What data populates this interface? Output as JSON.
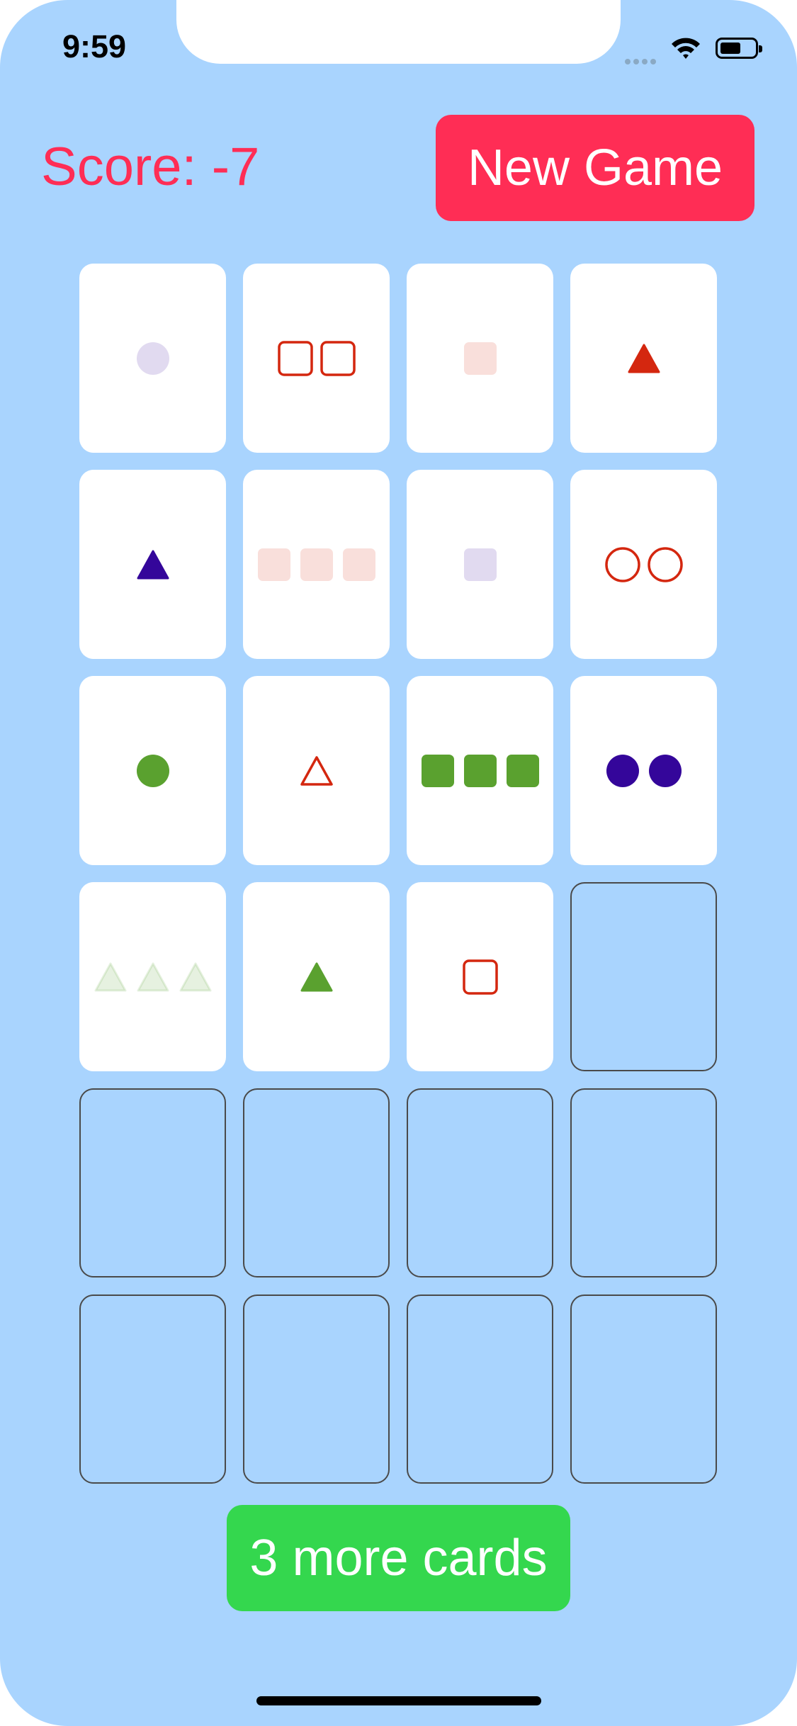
{
  "status_bar": {
    "time": "9:59",
    "signal_icon": "cellular-signal-icon",
    "wifi_icon": "wifi-icon",
    "battery_icon": "battery-icon"
  },
  "header": {
    "score_text": "Score: -7",
    "new_game_label": "New Game"
  },
  "colors": {
    "background": "#a9d4fe",
    "accent_red": "#ff2d55",
    "accent_green": "#34d74e",
    "card_red": "#d4270f",
    "card_green": "#5aa12f",
    "card_purple": "#34069a"
  },
  "cards": [
    {
      "count": 1,
      "shape": "circle",
      "color": "purple",
      "fill": "shaded"
    },
    {
      "count": 2,
      "shape": "square",
      "color": "red",
      "fill": "outline"
    },
    {
      "count": 1,
      "shape": "square",
      "color": "red",
      "fill": "shaded"
    },
    {
      "count": 1,
      "shape": "triangle",
      "color": "red",
      "fill": "solid"
    },
    {
      "count": 1,
      "shape": "triangle",
      "color": "purple",
      "fill": "solid"
    },
    {
      "count": 3,
      "shape": "square",
      "color": "red",
      "fill": "shaded"
    },
    {
      "count": 1,
      "shape": "square",
      "color": "purple",
      "fill": "shaded"
    },
    {
      "count": 2,
      "shape": "circle",
      "color": "red",
      "fill": "outline"
    },
    {
      "count": 1,
      "shape": "circle",
      "color": "green",
      "fill": "solid"
    },
    {
      "count": 1,
      "shape": "triangle",
      "color": "red",
      "fill": "outline"
    },
    {
      "count": 3,
      "shape": "square",
      "color": "green",
      "fill": "solid"
    },
    {
      "count": 2,
      "shape": "circle",
      "color": "purple",
      "fill": "solid"
    },
    {
      "count": 3,
      "shape": "triangle",
      "color": "green",
      "fill": "shaded"
    },
    {
      "count": 1,
      "shape": "triangle",
      "color": "green",
      "fill": "solid"
    },
    {
      "count": 1,
      "shape": "square",
      "color": "red",
      "fill": "outline"
    },
    {
      "empty": true
    },
    {
      "empty": true
    },
    {
      "empty": true
    },
    {
      "empty": true
    },
    {
      "empty": true
    },
    {
      "empty": true
    },
    {
      "empty": true
    },
    {
      "empty": true
    },
    {
      "empty": true
    }
  ],
  "footer": {
    "more_cards_label": "3 more cards"
  }
}
